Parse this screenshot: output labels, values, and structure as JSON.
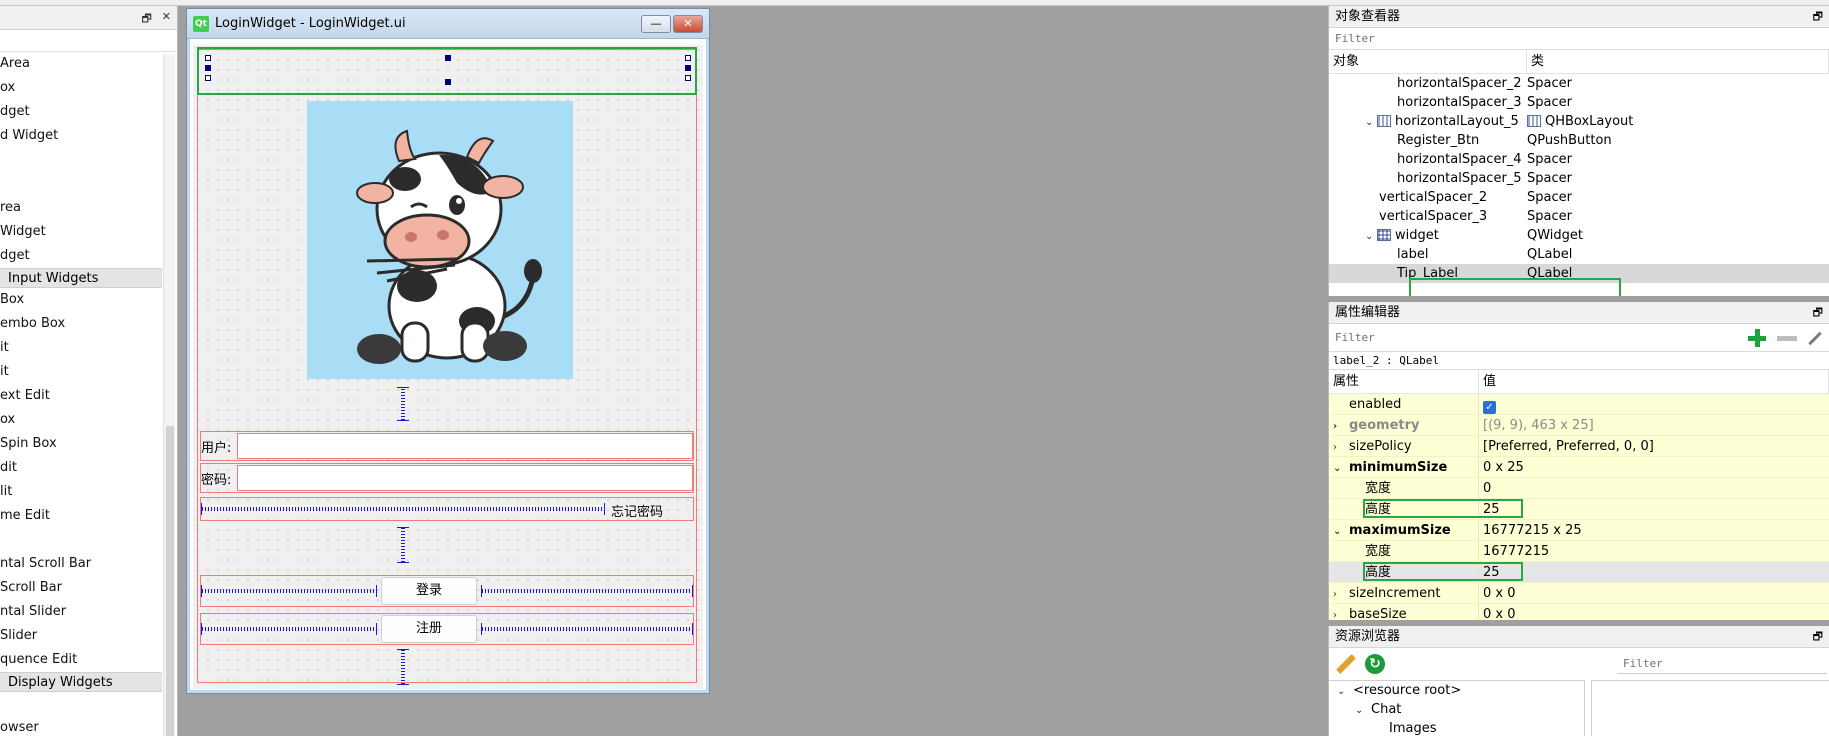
{
  "widget_box": {
    "title_buttons": [
      "🗗",
      "✕"
    ],
    "items": [
      {
        "label": "Area",
        "indent": 0
      },
      {
        "label": "ox",
        "indent": 0
      },
      {
        "label": "dget",
        "indent": 0
      },
      {
        "label": "d Widget",
        "indent": 0
      },
      {
        "label": "",
        "indent": 0
      },
      {
        "label": "",
        "indent": 0
      },
      {
        "label": "rea",
        "indent": 0
      },
      {
        "label": "Widget",
        "indent": 0
      },
      {
        "label": "dget",
        "indent": 0
      }
    ],
    "category_input": "Input Widgets",
    "input_items": [
      "Box",
      "embo Box",
      "it",
      "it",
      "ext Edit",
      "ox",
      "Spin Box",
      "dit",
      "lit",
      "me Edit",
      "",
      "ntal Scroll Bar",
      "Scroll Bar",
      "ntal Slider",
      "Slider",
      "quence Edit"
    ],
    "category_display": "Display Widgets",
    "display_items": [
      "",
      "owser"
    ]
  },
  "form": {
    "window_title": "LoginWidget - LoginWidget.ui",
    "qt_logo": "Qt",
    "controls": {
      "minimize": "—",
      "maximize": "▭",
      "close": "✕"
    },
    "user_label": "用户:",
    "password_label": "密码:",
    "forgot_password": "忘记密码",
    "login_button": "登录",
    "register_button": "注册"
  },
  "object_inspector": {
    "title": "对象查看器",
    "filter_placeholder": "Filter",
    "col_object": "对象",
    "col_class": "类",
    "rows": [
      {
        "name": "horizontalSpacer_2",
        "cls": "Spacer",
        "level": 3
      },
      {
        "name": "horizontalSpacer_3",
        "cls": "Spacer",
        "level": 3
      },
      {
        "name": "horizontalLayout_5",
        "cls": "QHBoxLayout",
        "level": 2,
        "expanded": true,
        "icon": "hbox"
      },
      {
        "name": "Register_Btn",
        "cls": "QPushButton",
        "level": 3
      },
      {
        "name": "horizontalSpacer_4",
        "cls": "Spacer",
        "level": 3
      },
      {
        "name": "horizontalSpacer_5",
        "cls": "Spacer",
        "level": 3
      },
      {
        "name": "verticalSpacer_2",
        "cls": "Spacer",
        "level": 2
      },
      {
        "name": "verticalSpacer_3",
        "cls": "Spacer",
        "level": 2
      },
      {
        "name": "widget",
        "cls": "QWidget",
        "level": 2,
        "expanded": true,
        "icon": "grid"
      },
      {
        "name": "label",
        "cls": "QLabel",
        "level": 3
      },
      {
        "name": "Tip_Label",
        "cls": "QLabel",
        "level": 3,
        "selected": true
      }
    ]
  },
  "property_editor": {
    "title": "属性编辑器",
    "filter_placeholder": "Filter",
    "selection": "label_2 : QLabel",
    "col_property": "属性",
    "col_value": "值",
    "rows": [
      {
        "name": "enabled",
        "value": "",
        "checkbox": true,
        "expander": ""
      },
      {
        "name": "geometry",
        "value": "[(9, 9), 463 x 25]",
        "bold": true,
        "grey": true,
        "expander": "›"
      },
      {
        "name": "sizePolicy",
        "value": "[Preferred, Preferred, 0, 0]",
        "expander": "›"
      },
      {
        "name": "minimumSize",
        "value": "0 x 25",
        "bold": true,
        "expander": "⌄"
      },
      {
        "name": "宽度",
        "value": "0",
        "sub": true
      },
      {
        "name": "高度",
        "value": "25",
        "sub": true,
        "highlight": true
      },
      {
        "name": "maximumSize",
        "value": "16777215 x 25",
        "bold": true,
        "expander": "⌄"
      },
      {
        "name": "宽度",
        "value": "16777215",
        "sub": true
      },
      {
        "name": "高度",
        "value": "25",
        "sub": true,
        "highlight": true,
        "selected": true
      },
      {
        "name": "sizeIncrement",
        "value": "0 x 0",
        "expander": "›"
      },
      {
        "name": "baseSize",
        "value": "0 x 0",
        "expander": "›"
      }
    ]
  },
  "resource_browser": {
    "title": "资源浏览器",
    "filter_placeholder": "Filter",
    "tree": [
      {
        "label": "<resource root>",
        "level": 0
      },
      {
        "label": "Chat",
        "level": 1
      },
      {
        "label": "Images",
        "level": 2
      }
    ]
  },
  "colors": {
    "selection_green": "#28a745",
    "layout_red": "#ef7b7b",
    "spacer_blue": "#1a1ad0",
    "property_yellow": "#ffffd6",
    "picture_bg": "#a9dcf5"
  }
}
